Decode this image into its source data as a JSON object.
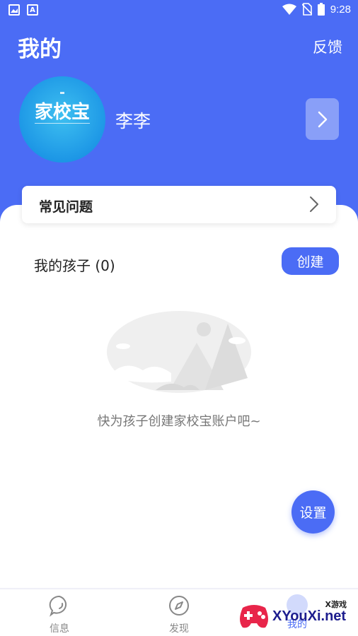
{
  "status_bar": {
    "time": "9:28",
    "left_icons": [
      "image-icon",
      "a-badge-icon"
    ]
  },
  "header": {
    "title": "我的",
    "feedback_label": "反馈"
  },
  "profile": {
    "avatar_text": "家校宝",
    "name": "李李"
  },
  "faq": {
    "label": "常见问题"
  },
  "children": {
    "title": "我的孩子 (0)",
    "create_label": "创建",
    "empty_text": "快为孩子创建家校宝账户吧~"
  },
  "fab": {
    "label": "设置"
  },
  "tabs": [
    {
      "label": "信息",
      "icon": "chat-bubble-icon"
    },
    {
      "label": "发现",
      "icon": "compass-icon"
    },
    {
      "label": "我的",
      "icon": "profile-icon"
    }
  ],
  "watermark": {
    "text": "XYouXi.net",
    "small": "X游戏"
  },
  "colors": {
    "primary": "#4b6cf5",
    "text": "#222222",
    "muted": "#777777"
  }
}
